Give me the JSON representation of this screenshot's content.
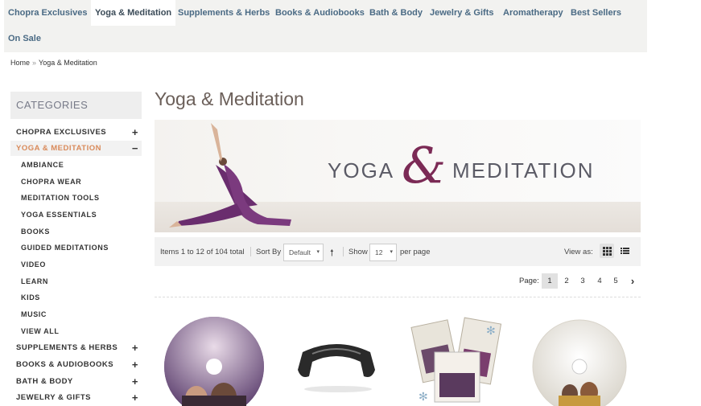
{
  "nav": {
    "items": [
      {
        "label": "Chopra Exclusives",
        "active": false
      },
      {
        "label": "Yoga & Meditation",
        "active": true
      },
      {
        "label": "Supplements & Herbs",
        "active": false
      },
      {
        "label": "Books & Audiobooks",
        "active": false
      },
      {
        "label": "Bath & Body",
        "active": false
      },
      {
        "label": "Jewelry & Gifts",
        "active": false
      },
      {
        "label": "Aromatherapy",
        "active": false
      },
      {
        "label": "Best Sellers",
        "active": false
      },
      {
        "label": "On Sale",
        "active": false
      }
    ]
  },
  "breadcrumb": {
    "home": "Home",
    "separator": "»",
    "current": "Yoga & Meditation"
  },
  "sidebar": {
    "heading": "CATEGORIES",
    "categories": [
      {
        "label": "CHOPRA EXCLUSIVES",
        "toggle": "+"
      },
      {
        "label": "YOGA & MEDITATION",
        "toggle": "−"
      }
    ],
    "subcategories": [
      "AMBIANCE",
      "CHOPRA WEAR",
      "MEDITATION TOOLS",
      "YOGA ESSENTIALS",
      "BOOKS",
      "GUIDED MEDITATIONS",
      "VIDEO",
      "LEARN",
      "KIDS",
      "MUSIC",
      "VIEW ALL"
    ],
    "more_categories": [
      {
        "label": "SUPPLEMENTS & HERBS",
        "toggle": "+"
      },
      {
        "label": "BOOKS & AUDIOBOOKS",
        "toggle": "+"
      },
      {
        "label": "BATH & BODY",
        "toggle": "+"
      },
      {
        "label": "JEWELRY & GIFTS",
        "toggle": "+"
      }
    ]
  },
  "main": {
    "title": "Yoga & Meditation",
    "banner": {
      "word1": "YOGA",
      "amp": "&",
      "word2": "MEDITATION"
    },
    "toolbar": {
      "items_total": "Items 1 to 12 of 104 total",
      "sort_label": "Sort By",
      "sort_value": "Default",
      "show_label": "Show",
      "show_value": "12",
      "per_page": "per page",
      "view_as": "View as:"
    },
    "pager": {
      "label": "Page:",
      "pages": [
        "1",
        "2",
        "3",
        "4",
        "5"
      ],
      "current": "1",
      "next": "›"
    }
  },
  "products": [
    {
      "name": "oprah-deepak-dvd-disc"
    },
    {
      "name": "muse-headband"
    },
    {
      "name": "believe-dvd-set"
    },
    {
      "name": "become-what-you-believe-disc"
    }
  ],
  "colors": {
    "nav_bg": "#f2f2f0",
    "nav_text": "#4a6a84",
    "accent": "#d98a5a",
    "title": "#6b5f59",
    "amp": "#7b2a55"
  }
}
